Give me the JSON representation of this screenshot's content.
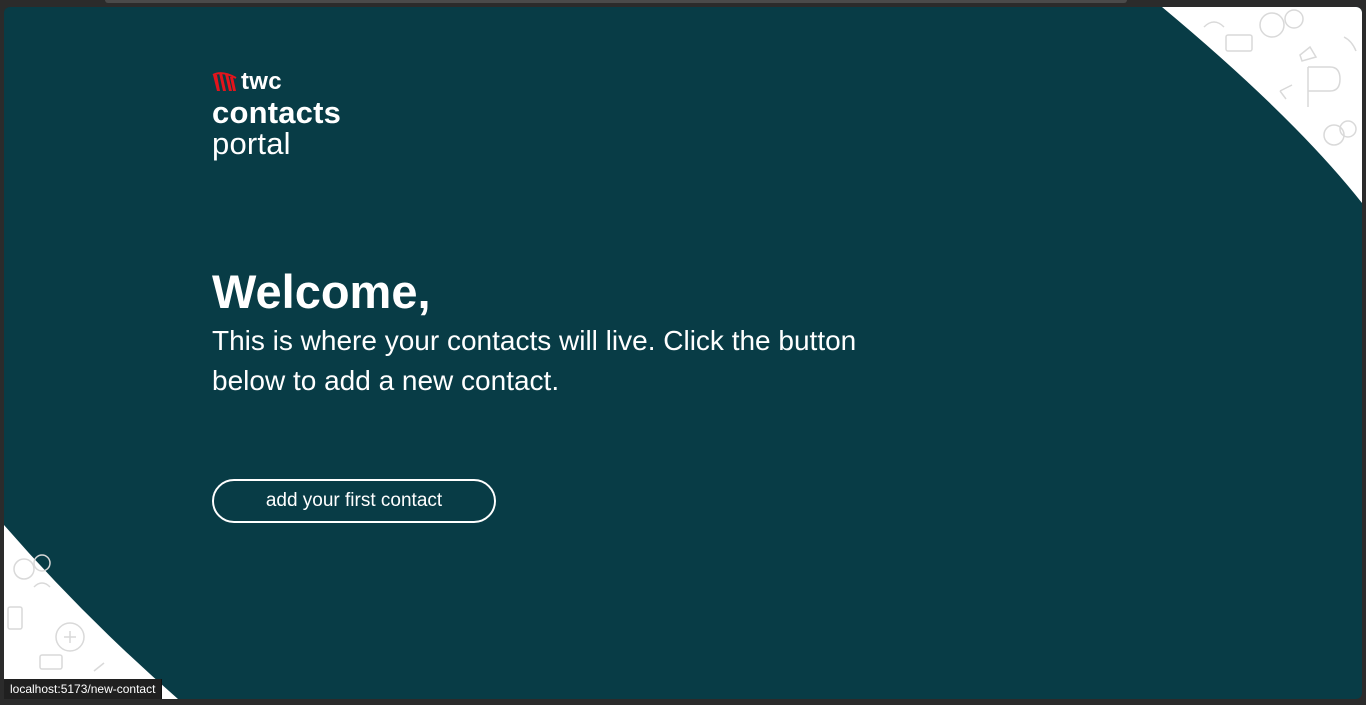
{
  "app": {
    "brand": "twc",
    "title_line1": "contacts",
    "title_line2": "portal",
    "brand_color": "#e3141c",
    "background_color": "#083c46",
    "logo_icon": "twc-wave-mark-icon"
  },
  "hero": {
    "heading": "Welcome,",
    "description": "This is where your contacts will live. Click the button below to add a new contact."
  },
  "actions": {
    "add_first_contact_label": "add your first contact"
  },
  "status_bar": {
    "link_preview": "localhost:5173/new-contact"
  }
}
